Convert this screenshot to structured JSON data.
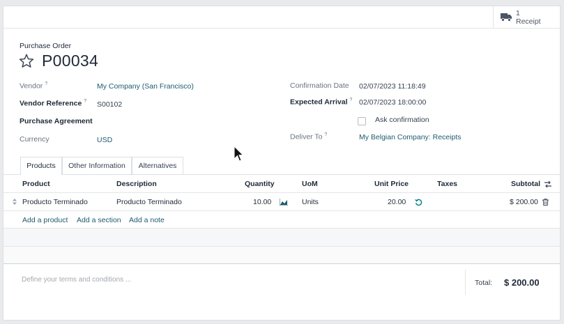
{
  "smart_button": {
    "count": "1",
    "label": "Receipt",
    "icon": "truck-icon"
  },
  "header": {
    "doc_type": "Purchase Order",
    "name": "P00034"
  },
  "fields_left": {
    "vendor_label": "Vendor",
    "vendor_value": "My Company (San Francisco)",
    "vendor_ref_label": "Vendor Reference",
    "vendor_ref_value": "S00102",
    "agreement_label": "Purchase Agreement",
    "currency_label": "Currency",
    "currency_value": "USD"
  },
  "fields_right": {
    "confirmation_label": "Confirmation Date",
    "confirmation_value": "02/07/2023 11:18:49",
    "expected_label": "Expected Arrival",
    "expected_value": "02/07/2023 18:00:00",
    "ask_confirmation_label": "Ask confirmation",
    "deliver_label": "Deliver To",
    "deliver_value": "My Belgian Company: Receipts"
  },
  "help_mark": "?",
  "tabs": [
    "Products",
    "Other Information",
    "Alternatives"
  ],
  "table": {
    "headers": [
      "Product",
      "Description",
      "Quantity",
      "UoM",
      "Unit Price",
      "Taxes",
      "Subtotal"
    ],
    "row": {
      "product": "Producto Terminado",
      "description": "Producto Terminado",
      "quantity": "10.00",
      "uom": "Units",
      "unit_price": "20.00",
      "taxes": "",
      "subtotal": "$ 200.00"
    },
    "add_product": "Add a product",
    "add_section": "Add a section",
    "add_note": "Add a note"
  },
  "footer": {
    "terms_placeholder": "Define your terms and conditions ...",
    "total_label": "Total:",
    "total_value": "$ 200.00"
  },
  "colors": {
    "link": "#1d5a6e",
    "accent_icon": "#017e84"
  }
}
